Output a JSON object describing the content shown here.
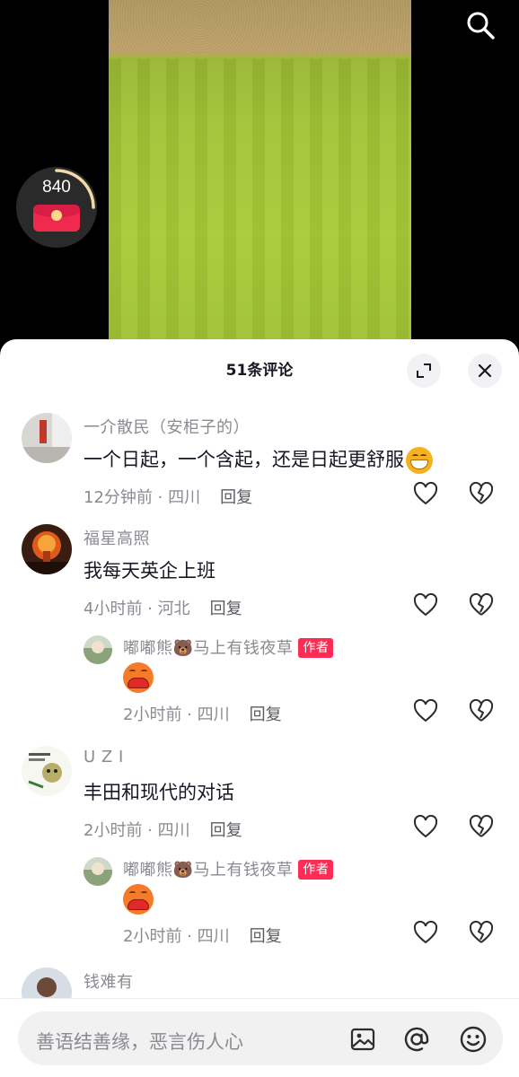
{
  "video": {
    "redpacket_count": "840"
  },
  "comments_panel": {
    "title": "51条评论"
  },
  "comments": [
    {
      "user": "一介散民（安柜子的）",
      "text": "一个日起，一个含起，还是日起更舒服",
      "emoji": "grin-emoji",
      "time": "12分钟前 · 四川",
      "reply_label": "回复"
    },
    {
      "user": "福星高照",
      "text": "我每天英企上班",
      "time": "4小时前 · 河北",
      "reply_label": "回复",
      "replies": [
        {
          "user": "嘟嘟熊🐻马上有钱夜草",
          "badge": "作者",
          "emoji": "crying-laugh-emoji",
          "time": "2小时前 · 四川",
          "reply_label": "回复"
        }
      ]
    },
    {
      "user": "U Z I",
      "text": "丰田和现代的对话",
      "time": "2小时前 · 四川",
      "reply_label": "回复",
      "replies": [
        {
          "user": "嘟嘟熊🐻马上有钱夜草",
          "badge": "作者",
          "emoji": "crying-laugh-emoji",
          "time": "2小时前 · 四川",
          "reply_label": "回复"
        }
      ]
    },
    {
      "user": "钱难有"
    }
  ],
  "input": {
    "placeholder": "善语结善缘，恶言伤人心"
  },
  "colors": {
    "accent": "#fe2c55",
    "text_primary": "#161823",
    "text_secondary": "#8a8b91"
  }
}
